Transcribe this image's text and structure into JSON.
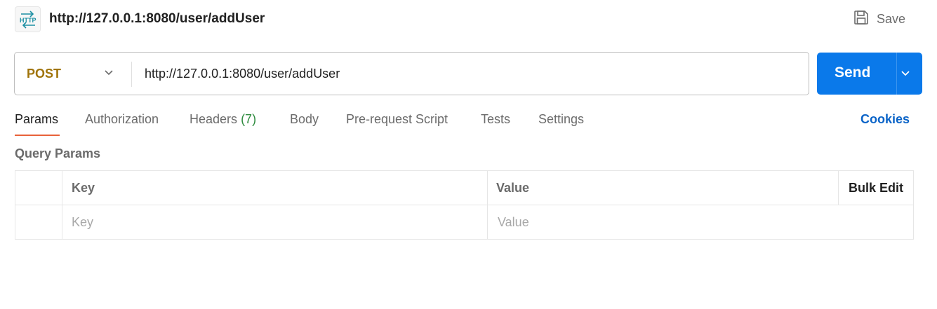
{
  "header": {
    "icon": "http-icon",
    "title": "http://127.0.0.1:8080/user/addUser",
    "save_label": "Save"
  },
  "request": {
    "method": "POST",
    "url": "http://127.0.0.1:8080/user/addUser",
    "send_label": "Send"
  },
  "tabs": [
    {
      "label": "Params",
      "active": true
    },
    {
      "label": "Authorization"
    },
    {
      "label": "Headers",
      "count": "(7)"
    },
    {
      "label": "Body"
    },
    {
      "label": "Pre-request Script"
    },
    {
      "label": "Tests"
    },
    {
      "label": "Settings"
    }
  ],
  "cookies_label": "Cookies",
  "query_params": {
    "title": "Query Params",
    "columns": {
      "key": "Key",
      "value": "Value",
      "bulk_edit": "Bulk Edit"
    },
    "placeholders": {
      "key": "Key",
      "value": "Value"
    }
  },
  "colors": {
    "accent": "#0a79ea",
    "method": "#a0740a",
    "active_tab_underline": "#e8623a",
    "count": "#2e8b3e",
    "link": "#0b64c8"
  }
}
